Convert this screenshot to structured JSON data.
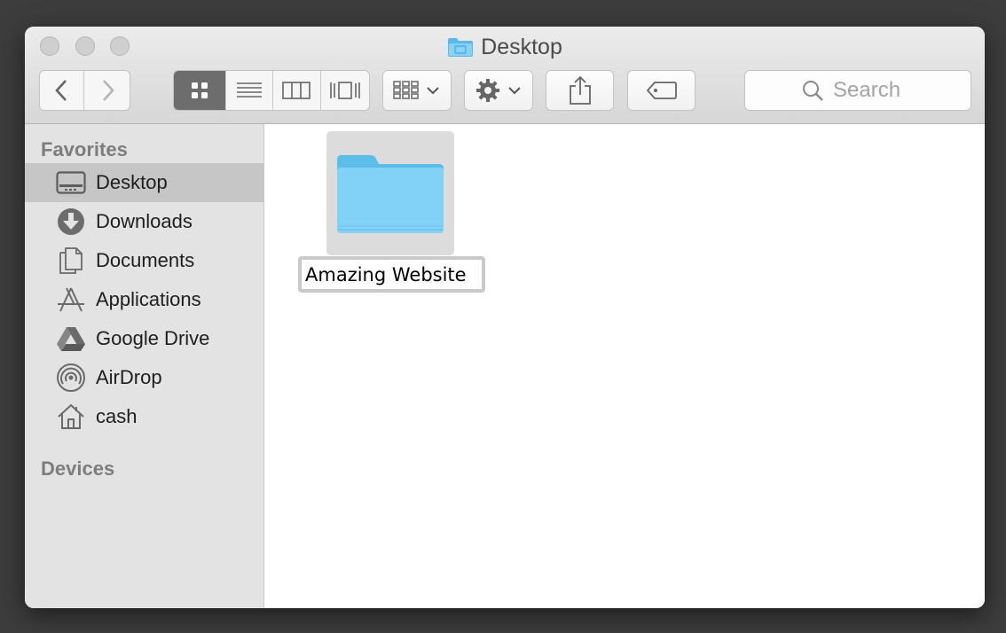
{
  "window": {
    "title": "Desktop"
  },
  "toolbar": {
    "back": "back",
    "forward": "forward",
    "views": [
      "icon-view",
      "list-view",
      "column-view",
      "cover-flow-view"
    ],
    "arrange": "arrange",
    "action": "action",
    "share": "share",
    "tags": "tags",
    "search_placeholder": "Search"
  },
  "sidebar": {
    "favorites_title": "Favorites",
    "items": [
      {
        "label": "Desktop",
        "icon": "desktop-icon",
        "selected": true
      },
      {
        "label": "Downloads",
        "icon": "downloads-icon"
      },
      {
        "label": "Documents",
        "icon": "documents-icon"
      },
      {
        "label": "Applications",
        "icon": "applications-icon"
      },
      {
        "label": "Google Drive",
        "icon": "google-drive-icon"
      },
      {
        "label": "AirDrop",
        "icon": "airdrop-icon"
      },
      {
        "label": "cash",
        "icon": "home-icon"
      }
    ],
    "devices_title": "Devices"
  },
  "content": {
    "items": [
      {
        "name": "Amazing Website",
        "type": "folder",
        "editing": true
      }
    ]
  },
  "colors": {
    "folder": "#7ccff5",
    "selection": "#c6c6c6"
  }
}
